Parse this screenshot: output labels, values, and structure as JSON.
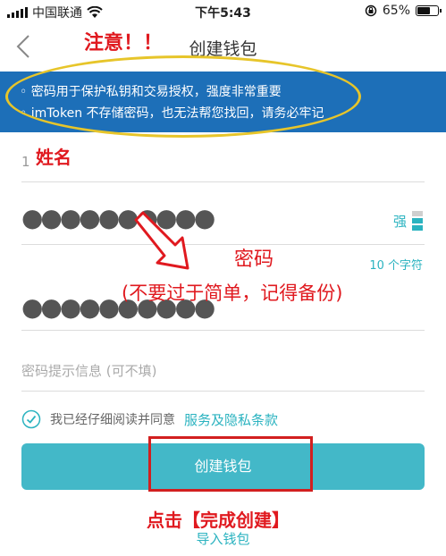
{
  "status_bar": {
    "carrier": "中国联通",
    "time": "下午5:43",
    "battery_percent": "65%",
    "battery_level": 0.65,
    "icons": [
      "signal-icon",
      "wifi-icon",
      "rotation-lock-icon",
      "battery-icon"
    ]
  },
  "nav": {
    "title": "创建钱包",
    "back_icon": "chevron-left-icon"
  },
  "banner": {
    "line1": "密码用于保护私钥和交易授权，强度非常重要",
    "line2": "imToken 不存储密码，也无法帮您找回，请务必牢记",
    "background": "#1d6fb8"
  },
  "form": {
    "name_value": "1",
    "password_masked": "●●●●●●●●●●",
    "confirm_masked": "●●●●●●●●●●",
    "strength_label": "强",
    "strength_level": 0.66,
    "char_count": "10 个字符",
    "hint_placeholder": "密码提示信息 (可不填)"
  },
  "agreement": {
    "text": "我已经仔细阅读并同意",
    "link": "服务及隐私条款",
    "checked": true
  },
  "buttons": {
    "create": "创建钱包",
    "import": "导入钱包"
  },
  "annotations": {
    "notice": "注意！！",
    "name": "姓名",
    "password": "密码",
    "not_simple": "(不要过于简单，记得备份)",
    "click_finish": "点击【完成创建】"
  },
  "colors": {
    "accent": "#43b8c8",
    "link": "#2bb3c0",
    "annotation_red": "#e0191f",
    "highlight_yellow": "#e7c52a"
  }
}
